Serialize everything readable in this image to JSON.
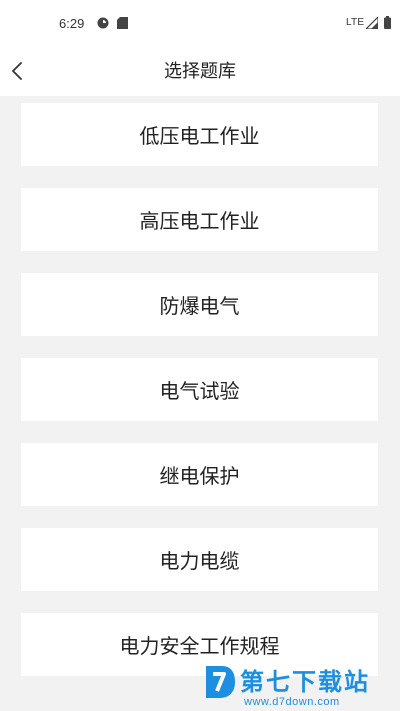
{
  "status_bar": {
    "time": "6:29",
    "network": "LTE",
    "icons": [
      "circle-app-icon",
      "sd-card-icon",
      "signal-icon",
      "battery-icon"
    ]
  },
  "header": {
    "title": "选择题库",
    "back_icon": "chevron-left-icon"
  },
  "question_banks": [
    {
      "label": "低压电工作业"
    },
    {
      "label": "高压电工作业"
    },
    {
      "label": "防爆电气"
    },
    {
      "label": "电气试验"
    },
    {
      "label": "继电保护"
    },
    {
      "label": "电力电缆"
    },
    {
      "label": "电力安全工作规程"
    }
  ],
  "watermark": {
    "title": "第七下载站",
    "url": "www.d7down.com",
    "color": "#1d8fe0"
  },
  "colors": {
    "background": "#f2f2f2",
    "card": "#ffffff",
    "text": "#222222"
  }
}
